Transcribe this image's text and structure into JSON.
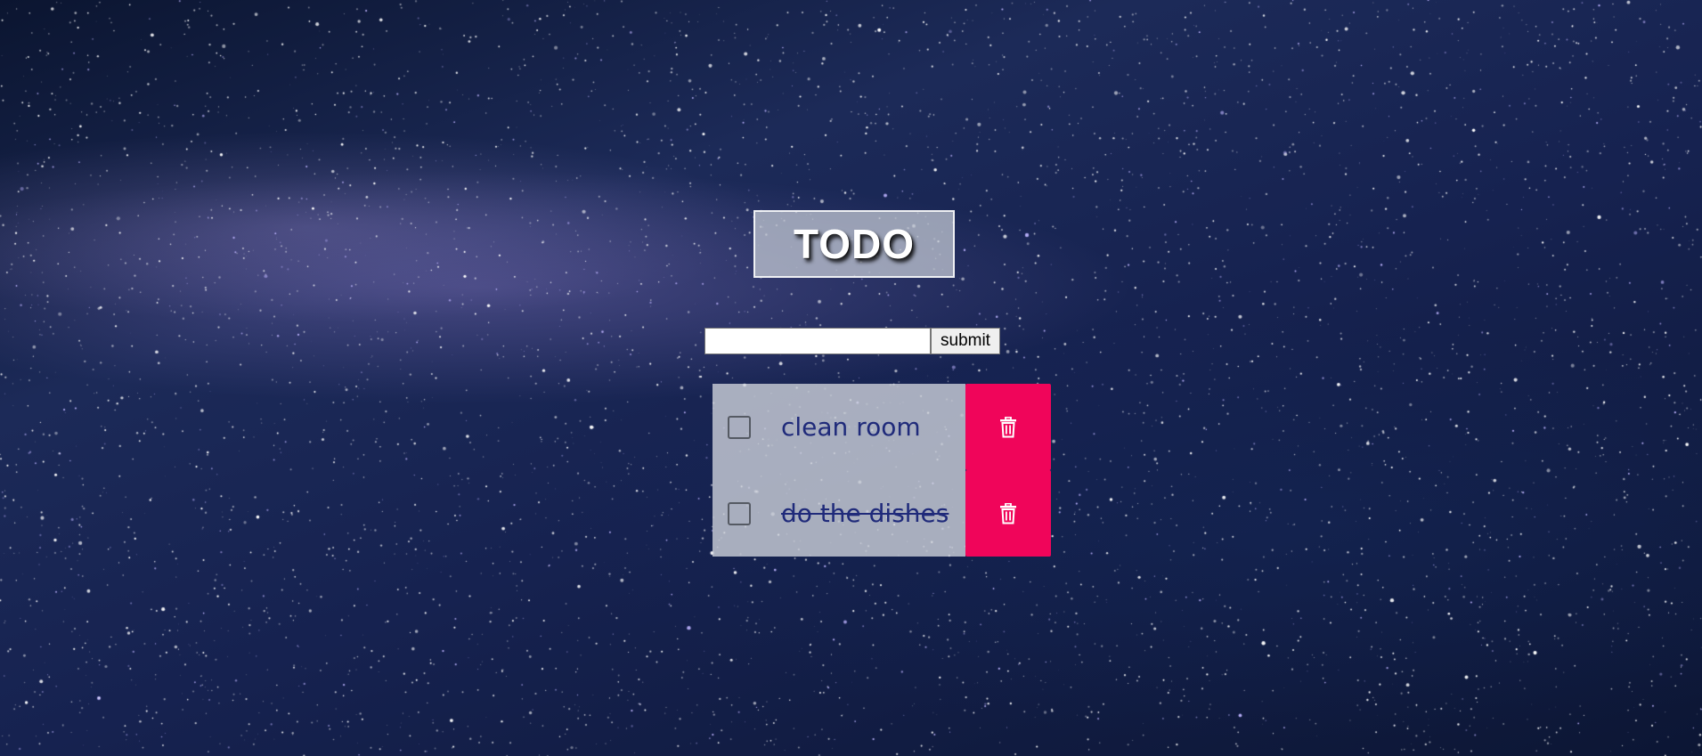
{
  "header": {
    "title": "TODO"
  },
  "form": {
    "input_value": "",
    "input_placeholder": "",
    "submit_label": "submit"
  },
  "todos": [
    {
      "text": "clean room",
      "completed": false,
      "checked": false
    },
    {
      "text": "do the dishes",
      "completed": true,
      "checked": false
    }
  ],
  "icons": {
    "delete": "trash-icon",
    "checkbox": "checkbox-icon"
  },
  "colors": {
    "delete_button": "#f0055a",
    "todo_text": "#1f2a7a",
    "card_background": "#d2d6de"
  }
}
